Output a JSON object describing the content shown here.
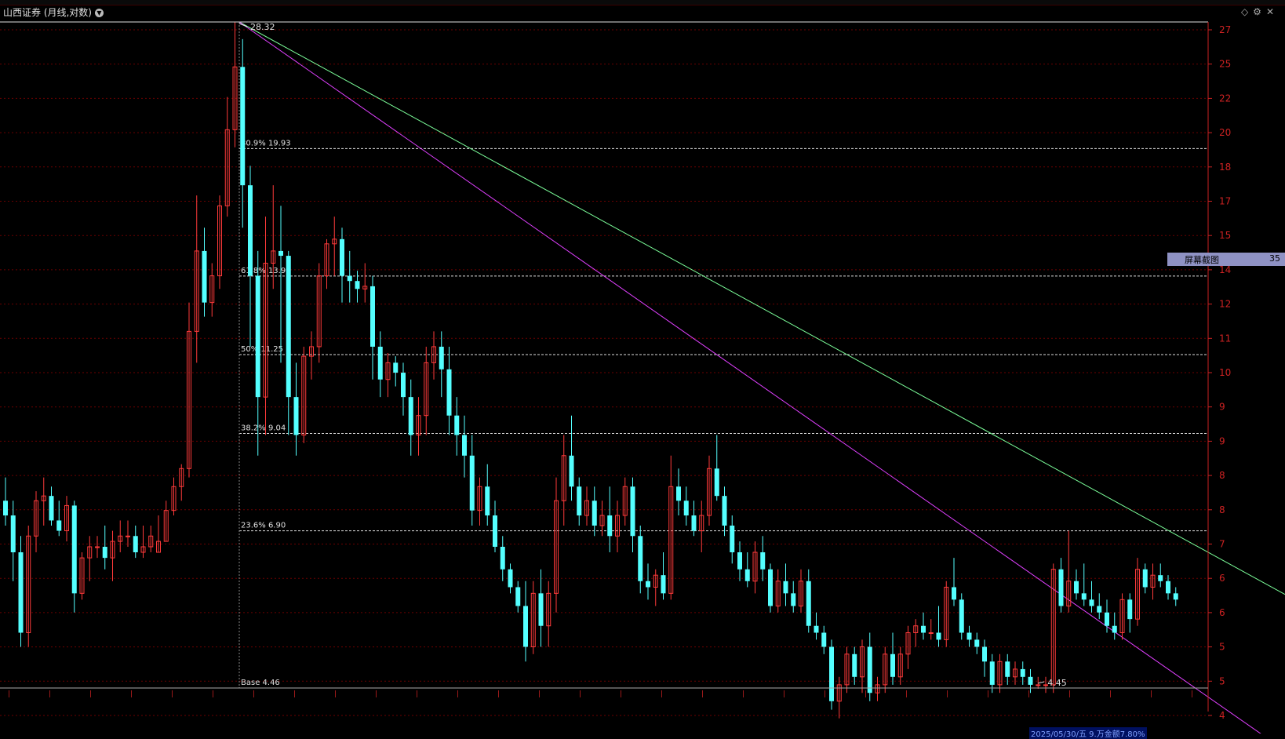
{
  "window": {
    "title": "山西证券 (月线,对数)",
    "dropdown_icon": "chevron-down-icon",
    "icons": [
      "diamond-icon",
      "gear-icon",
      "close-icon"
    ]
  },
  "context_menu": {
    "label": "屏幕截图",
    "value": "35"
  },
  "bottom_tip": "2025/05/30/五 9.万金额7.80%",
  "colors": {
    "up": "#ff3a3a",
    "down": "#54ffff",
    "green_line": "#7cff9a",
    "magenta_line": "#e040ff",
    "grid": "#6b0000",
    "axis": "#cc2222"
  },
  "chart_data": {
    "type": "candlestick",
    "scale": "log",
    "y_axis_ticks": [
      "27",
      "25",
      "22",
      "20",
      "18",
      "17",
      "15",
      "14",
      "12",
      "11",
      "10",
      "9",
      "9",
      "8",
      "8",
      "7",
      "6",
      "6",
      "5",
      "5",
      "4"
    ],
    "fibonacci": [
      {
        "label": "80.9% 19.93",
        "value": 19.93
      },
      {
        "label": "61.8% 13.99",
        "value": 13.99
      },
      {
        "label": "50% 11.25",
        "value": 11.25
      },
      {
        "label": "38.2% 9.04",
        "value": 9.04
      },
      {
        "label": "23.6% 6.90",
        "value": 6.9
      },
      {
        "label": "Base 4.46",
        "value": 4.46
      }
    ],
    "high_label": "28.32",
    "low_label": "4.45",
    "trendlines": [
      {
        "name": "green",
        "from": [
          37,
          28.32
        ],
        "to": [
          180,
          6.5
        ]
      },
      {
        "name": "magenta",
        "from": [
          37,
          28.32
        ],
        "to": [
          180,
          4.35
        ]
      }
    ],
    "candles": [
      [
        0,
        7.5,
        8.0,
        7.0,
        7.2
      ],
      [
        1,
        7.2,
        7.5,
        6.0,
        6.5
      ],
      [
        2,
        6.5,
        6.8,
        5.0,
        5.2
      ],
      [
        3,
        5.2,
        7.0,
        5.0,
        6.8
      ],
      [
        4,
        6.8,
        7.7,
        6.5,
        7.5
      ],
      [
        5,
        7.5,
        8.0,
        7.0,
        7.6
      ],
      [
        6,
        7.6,
        7.8,
        7.0,
        7.1
      ],
      [
        7,
        7.1,
        7.5,
        6.8,
        6.9
      ],
      [
        8,
        6.9,
        7.6,
        6.7,
        7.4
      ],
      [
        9,
        7.4,
        7.5,
        5.5,
        5.8
      ],
      [
        10,
        5.8,
        6.5,
        5.7,
        6.4
      ],
      [
        11,
        6.4,
        6.8,
        6.0,
        6.6
      ],
      [
        12,
        6.6,
        6.8,
        6.4,
        6.6
      ],
      [
        13,
        6.6,
        7.0,
        6.2,
        6.4
      ],
      [
        14,
        6.4,
        6.9,
        6.0,
        6.7
      ],
      [
        15,
        6.7,
        7.1,
        6.5,
        6.8
      ],
      [
        16,
        6.8,
        7.1,
        6.6,
        6.8
      ],
      [
        17,
        6.8,
        7.0,
        6.4,
        6.5
      ],
      [
        18,
        6.5,
        7.0,
        6.4,
        6.6
      ],
      [
        19,
        6.6,
        7.0,
        6.5,
        6.8
      ],
      [
        20,
        6.5,
        7.2,
        6.5,
        6.7
      ],
      [
        21,
        6.7,
        7.5,
        6.7,
        7.3
      ],
      [
        22,
        7.3,
        8.0,
        7.2,
        7.8
      ],
      [
        23,
        7.8,
        8.3,
        7.5,
        8.2
      ],
      [
        24,
        8.2,
        13.0,
        8.0,
        12.0
      ],
      [
        25,
        12.0,
        17.5,
        11.0,
        15.0
      ],
      [
        26,
        15.0,
        16.0,
        12.5,
        13.0
      ],
      [
        27,
        13.0,
        14.5,
        12.5,
        14.0
      ],
      [
        28,
        14.0,
        17.5,
        13.5,
        17.0
      ],
      [
        29,
        17.0,
        23.0,
        16.5,
        21.0
      ],
      [
        30,
        21.0,
        28.32,
        20.0,
        25.0
      ],
      [
        31,
        25.0,
        27.0,
        16.0,
        18.0
      ],
      [
        32,
        18.0,
        19.0,
        11.5,
        14.0
      ],
      [
        33,
        14.0,
        15.0,
        8.5,
        10.0
      ],
      [
        34,
        10.0,
        16.5,
        9.0,
        14.5
      ],
      [
        35,
        14.5,
        18.0,
        13.5,
        15.0
      ],
      [
        36,
        15.0,
        17.0,
        11.0,
        14.8
      ],
      [
        37,
        14.8,
        15.0,
        9.0,
        10.0
      ],
      [
        38,
        10.0,
        11.0,
        8.5,
        9.0
      ],
      [
        39,
        9.0,
        11.5,
        8.8,
        11.2
      ],
      [
        40,
        11.2,
        12.0,
        10.5,
        11.5
      ],
      [
        41,
        11.5,
        14.5,
        11.0,
        14.0
      ],
      [
        42,
        14.0,
        15.5,
        13.5,
        15.3
      ],
      [
        43,
        15.3,
        16.5,
        14.0,
        15.5
      ],
      [
        44,
        15.5,
        16.0,
        13.0,
        14.0
      ],
      [
        45,
        14.0,
        15.0,
        13.0,
        13.8
      ],
      [
        46,
        13.8,
        14.2,
        13.0,
        13.5
      ],
      [
        47,
        13.5,
        14.5,
        13.0,
        13.6
      ],
      [
        48,
        13.6,
        14.0,
        10.5,
        11.5
      ],
      [
        49,
        11.5,
        12.0,
        10.0,
        10.5
      ],
      [
        50,
        10.5,
        11.3,
        10.0,
        11.0
      ],
      [
        51,
        11.0,
        11.2,
        10.3,
        10.7
      ],
      [
        52,
        10.7,
        11.0,
        9.5,
        10.0
      ],
      [
        53,
        10.0,
        10.5,
        8.5,
        9.0
      ],
      [
        54,
        9.0,
        10.0,
        8.5,
        9.5
      ],
      [
        55,
        9.5,
        11.5,
        9.0,
        11.0
      ],
      [
        56,
        11.0,
        12.0,
        10.5,
        11.5
      ],
      [
        57,
        11.5,
        12.0,
        10.0,
        10.8
      ],
      [
        58,
        10.8,
        11.5,
        9.0,
        9.5
      ],
      [
        59,
        9.5,
        10.0,
        8.5,
        9.0
      ],
      [
        60,
        9.0,
        9.5,
        8.0,
        8.5
      ],
      [
        61,
        8.5,
        9.0,
        7.0,
        7.3
      ],
      [
        62,
        7.3,
        8.0,
        7.0,
        7.8
      ],
      [
        63,
        7.8,
        8.3,
        7.0,
        7.2
      ],
      [
        64,
        7.2,
        7.5,
        6.5,
        6.6
      ],
      [
        65,
        6.6,
        6.8,
        6.0,
        6.2
      ],
      [
        66,
        6.2,
        6.3,
        5.8,
        5.9
      ],
      [
        67,
        5.9,
        6.0,
        5.5,
        5.6
      ],
      [
        68,
        5.6,
        6.0,
        4.8,
        5.0
      ],
      [
        69,
        5.0,
        6.0,
        4.9,
        5.8
      ],
      [
        70,
        5.8,
        6.2,
        5.0,
        5.3
      ],
      [
        71,
        5.3,
        6.0,
        5.0,
        5.8
      ],
      [
        72,
        5.8,
        8.0,
        5.5,
        7.5
      ],
      [
        73,
        7.5,
        9.0,
        7.0,
        8.5
      ],
      [
        74,
        8.5,
        9.5,
        7.5,
        7.8
      ],
      [
        75,
        7.8,
        8.0,
        7.0,
        7.2
      ],
      [
        76,
        7.2,
        7.8,
        7.0,
        7.5
      ],
      [
        77,
        7.5,
        7.8,
        6.8,
        7.0
      ],
      [
        78,
        7.0,
        7.5,
        6.8,
        7.2
      ],
      [
        79,
        7.2,
        7.8,
        6.5,
        6.8
      ],
      [
        80,
        6.8,
        7.5,
        6.5,
        7.2
      ],
      [
        81,
        7.2,
        8.0,
        7.0,
        7.8
      ],
      [
        82,
        7.8,
        8.0,
        6.5,
        6.8
      ],
      [
        83,
        6.8,
        7.0,
        5.8,
        6.0
      ],
      [
        84,
        6.0,
        6.3,
        5.7,
        5.9
      ],
      [
        85,
        5.9,
        6.2,
        5.6,
        6.1
      ],
      [
        86,
        6.1,
        6.5,
        5.7,
        5.8
      ],
      [
        87,
        5.8,
        8.5,
        5.7,
        7.8
      ],
      [
        88,
        7.8,
        8.2,
        7.2,
        7.5
      ],
      [
        89,
        7.5,
        7.8,
        7.0,
        7.2
      ],
      [
        90,
        7.2,
        7.5,
        6.8,
        6.9
      ],
      [
        91,
        6.9,
        7.5,
        6.5,
        7.2
      ],
      [
        92,
        7.2,
        8.5,
        7.0,
        8.2
      ],
      [
        93,
        8.2,
        9.0,
        7.5,
        7.6
      ],
      [
        94,
        7.6,
        7.8,
        6.8,
        7.0
      ],
      [
        95,
        7.0,
        7.2,
        6.3,
        6.5
      ],
      [
        96,
        6.5,
        6.7,
        6.0,
        6.2
      ],
      [
        97,
        6.2,
        6.5,
        5.9,
        6.0
      ],
      [
        98,
        6.0,
        6.7,
        5.8,
        6.5
      ],
      [
        99,
        6.5,
        6.8,
        6.0,
        6.2
      ],
      [
        100,
        6.2,
        6.3,
        5.5,
        5.6
      ],
      [
        101,
        5.6,
        6.2,
        5.5,
        6.0
      ],
      [
        102,
        6.0,
        6.3,
        5.6,
        5.8
      ],
      [
        103,
        5.8,
        6.0,
        5.5,
        5.6
      ],
      [
        104,
        5.6,
        6.2,
        5.5,
        6.0
      ],
      [
        105,
        6.0,
        6.2,
        5.2,
        5.3
      ],
      [
        106,
        5.3,
        5.5,
        5.1,
        5.2
      ],
      [
        107,
        5.2,
        5.3,
        4.9,
        5.0
      ],
      [
        108,
        5.0,
        5.1,
        4.2,
        4.3
      ],
      [
        109,
        4.3,
        4.6,
        4.1,
        4.5
      ],
      [
        110,
        4.5,
        5.0,
        4.4,
        4.9
      ],
      [
        111,
        4.9,
        5.0,
        4.5,
        4.6
      ],
      [
        112,
        4.6,
        5.1,
        4.4,
        5.0
      ],
      [
        113,
        5.0,
        5.2,
        4.3,
        4.4
      ],
      [
        114,
        4.4,
        4.6,
        4.3,
        4.5
      ],
      [
        115,
        4.5,
        5.0,
        4.4,
        4.9
      ],
      [
        116,
        4.9,
        5.2,
        4.5,
        4.6
      ],
      [
        117,
        4.6,
        5.0,
        4.5,
        4.9
      ],
      [
        118,
        4.9,
        5.3,
        4.7,
        5.2
      ],
      [
        119,
        5.2,
        5.4,
        5.0,
        5.3
      ],
      [
        120,
        5.3,
        5.5,
        5.1,
        5.2
      ],
      [
        121,
        5.2,
        5.4,
        5.1,
        5.2
      ],
      [
        122,
        5.2,
        5.6,
        5.0,
        5.1
      ],
      [
        123,
        5.1,
        6.0,
        5.0,
        5.9
      ],
      [
        124,
        5.9,
        6.4,
        5.6,
        5.7
      ],
      [
        125,
        5.7,
        5.8,
        5.1,
        5.2
      ],
      [
        126,
        5.2,
        5.3,
        5.0,
        5.1
      ],
      [
        127,
        5.1,
        5.2,
        4.9,
        5.0
      ],
      [
        128,
        5.0,
        5.1,
        4.6,
        4.8
      ],
      [
        129,
        4.8,
        4.9,
        4.4,
        4.5
      ],
      [
        130,
        4.5,
        4.9,
        4.4,
        4.8
      ],
      [
        131,
        4.8,
        4.9,
        4.5,
        4.6
      ],
      [
        132,
        4.6,
        4.8,
        4.5,
        4.7
      ],
      [
        133,
        4.7,
        4.8,
        4.5,
        4.6
      ],
      [
        134,
        4.6,
        4.7,
        4.4,
        4.5
      ],
      [
        135,
        4.5,
        4.6,
        4.45,
        4.5
      ],
      [
        136,
        4.5,
        4.6,
        4.4,
        4.5
      ],
      [
        137,
        4.5,
        6.3,
        4.4,
        6.2
      ],
      [
        138,
        6.2,
        6.4,
        5.5,
        5.6
      ],
      [
        139,
        5.6,
        6.9,
        5.5,
        6.0
      ],
      [
        140,
        6.0,
        6.2,
        5.7,
        5.8
      ],
      [
        141,
        5.8,
        6.3,
        5.6,
        5.7
      ],
      [
        142,
        5.7,
        6.0,
        5.5,
        5.6
      ],
      [
        143,
        5.6,
        5.8,
        5.4,
        5.5
      ],
      [
        144,
        5.5,
        5.7,
        5.2,
        5.3
      ],
      [
        145,
        5.3,
        5.5,
        5.1,
        5.2
      ],
      [
        146,
        5.2,
        5.8,
        5.1,
        5.7
      ],
      [
        147,
        5.7,
        5.8,
        5.2,
        5.4
      ],
      [
        148,
        5.4,
        6.4,
        5.3,
        6.2
      ],
      [
        149,
        6.2,
        6.3,
        5.8,
        5.9
      ],
      [
        150,
        5.9,
        6.3,
        5.7,
        6.1
      ],
      [
        151,
        6.1,
        6.3,
        5.9,
        6.0
      ],
      [
        152,
        6.0,
        6.1,
        5.7,
        5.8
      ],
      [
        153,
        5.8,
        5.9,
        5.6,
        5.7
      ]
    ]
  }
}
